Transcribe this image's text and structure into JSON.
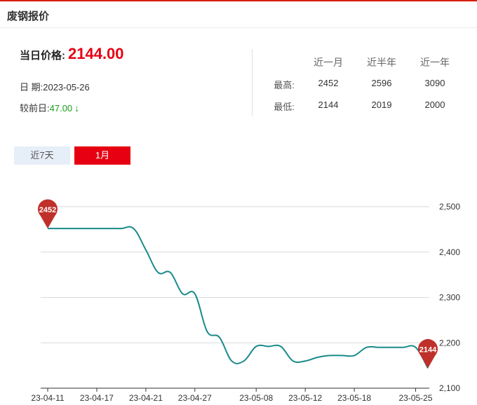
{
  "panel": {
    "title": "废钢报价"
  },
  "price": {
    "label": "当日价格:",
    "value": "2144.00",
    "date_label": "日 期:",
    "date_value": "2023-05-26",
    "change_label": "较前日:",
    "change_value": "47.00",
    "change_arrow": "↓"
  },
  "stats": {
    "headers": [
      "近一月",
      "近半年",
      "近一年"
    ],
    "rows": [
      {
        "label": "最高:",
        "values": [
          "2452",
          "2596",
          "3090"
        ]
      },
      {
        "label": "最低:",
        "values": [
          "2144",
          "2019",
          "2000"
        ]
      }
    ]
  },
  "tabs": [
    {
      "label": "近7天",
      "active": false
    },
    {
      "label": "1月",
      "active": true
    }
  ],
  "colors": {
    "accent": "#e60012",
    "line": "#1a8a8a",
    "pin": "#c0302a",
    "change": "#1a9e1a",
    "grid": "#d9d9d9"
  },
  "chart_data": {
    "type": "line",
    "x_tick_labels": [
      "23-04-11",
      "23-04-17",
      "23-04-21",
      "23-04-27",
      "23-05-08",
      "23-05-12",
      "23-05-18",
      "23-05-25"
    ],
    "y_tick_labels": [
      "2,500",
      "2,400",
      "2,300",
      "2,200",
      "2,100"
    ],
    "ylim": [
      2100,
      2500
    ],
    "x": [
      "04-11",
      "04-12",
      "04-13",
      "04-14",
      "04-17",
      "04-18",
      "04-19",
      "04-20",
      "04-21",
      "04-24",
      "04-25",
      "04-26",
      "04-27",
      "04-28",
      "05-04",
      "05-05",
      "05-06",
      "05-08",
      "05-09",
      "05-10",
      "05-11",
      "05-12",
      "05-15",
      "05-16",
      "05-17",
      "05-18",
      "05-19",
      "05-22",
      "05-23",
      "05-24",
      "05-25",
      "05-26"
    ],
    "series": [
      {
        "values": [
          2452,
          2452,
          2452,
          2452,
          2452,
          2452,
          2452,
          2452,
          2405,
          2355,
          2355,
          2308,
          2308,
          2225,
          2212,
          2160,
          2160,
          2192,
          2192,
          2192,
          2160,
          2160,
          2168,
          2172,
          2172,
          2172,
          2190,
          2190,
          2190,
          2190,
          2190,
          2144
        ]
      }
    ],
    "pins": [
      {
        "label": "2452",
        "index": 0,
        "value": 2452
      },
      {
        "label": "2144",
        "index": 31,
        "value": 2144
      }
    ],
    "grid": true
  }
}
